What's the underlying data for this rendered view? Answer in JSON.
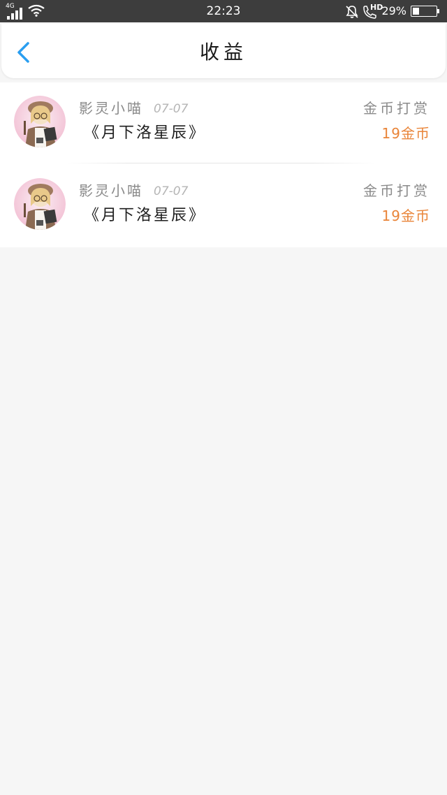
{
  "status_bar": {
    "network": "4G",
    "time": "22:23",
    "battery_pct": "29%",
    "battery_level": 0.29,
    "icons": [
      "signal-icon",
      "wifi-icon",
      "bell-muted-icon",
      "phone-hd-icon",
      "battery-icon"
    ],
    "hd_label": "HD"
  },
  "header": {
    "title": "收益",
    "back_icon": "chevron-left-icon",
    "accent_color": "#2a9ef0"
  },
  "earnings": [
    {
      "user": "影灵小喵",
      "date": "07-07",
      "book": "《月下洛星辰》",
      "type": "金币打赏",
      "amount": "19金币"
    },
    {
      "user": "影灵小喵",
      "date": "07-07",
      "book": "《月下洛星辰》",
      "type": "金币打赏",
      "amount": "19金币"
    }
  ],
  "colors": {
    "amount": "#e98438",
    "status_bar": "#3d3d3d",
    "page_bg": "#f6f6f6"
  }
}
